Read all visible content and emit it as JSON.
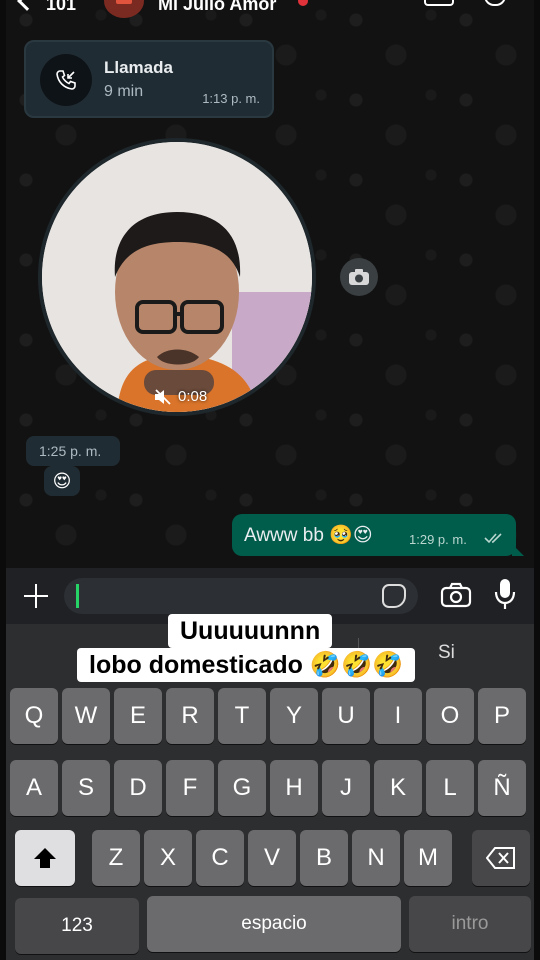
{
  "header": {
    "back_count": "101",
    "contact_name": "Mi Julio Amor"
  },
  "call": {
    "title": "Llamada",
    "duration": "9 min",
    "time": "1:13 p. m."
  },
  "video_note": {
    "duration": "0:08"
  },
  "received": {
    "time": "1:25 p. m.",
    "emoji": "😍"
  },
  "sent": {
    "text": "Awww bb 🥹😍",
    "time": "1:29 p. m."
  },
  "keyboard": {
    "suggestion": "Si",
    "row1": [
      "Q",
      "W",
      "E",
      "R",
      "T",
      "Y",
      "U",
      "I",
      "O",
      "P"
    ],
    "row2": [
      "A",
      "S",
      "D",
      "F",
      "G",
      "H",
      "J",
      "K",
      "L",
      "Ñ"
    ],
    "row3": [
      "Z",
      "X",
      "C",
      "V",
      "B",
      "N",
      "M"
    ],
    "numbers_label": "123",
    "space_label": "espacio",
    "return_label": "intro"
  },
  "caption": {
    "line1": "Uuuuuunnn",
    "line2": "lobo domesticado 🤣🤣🤣"
  },
  "colors": {
    "accent": "#25d366",
    "sent_bubble": "#005c4b",
    "received_bubble": "#202c33"
  }
}
